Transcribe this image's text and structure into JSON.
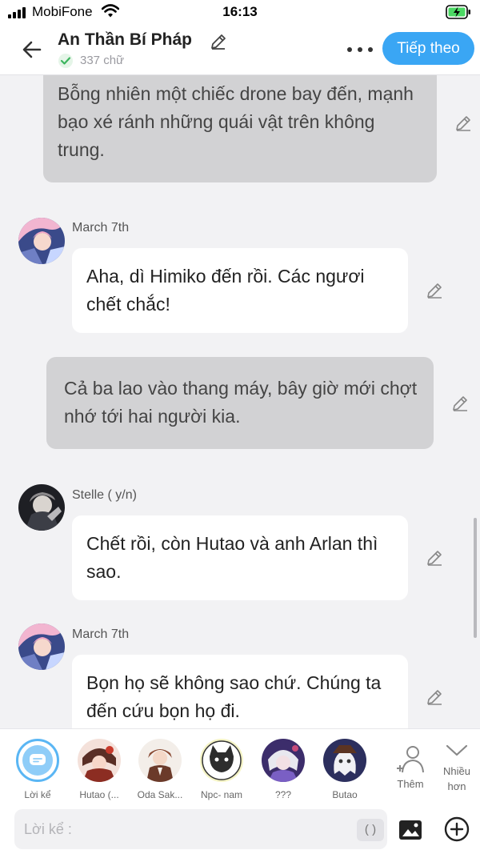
{
  "status_bar": {
    "carrier": "MobiFone",
    "time": "16:13"
  },
  "header": {
    "title": "An Thần Bí Pháp",
    "word_count": "337 chữ",
    "next_label": "Tiếp theo",
    "icons": {
      "back": "arrow-left-icon",
      "edit": "pencil-icon",
      "verified": "check-circle-icon",
      "more": "more-dots-icon"
    }
  },
  "messages": [
    {
      "type": "narration",
      "text": "Bỗng nhiên một chiếc drone bay đến, mạnh bạo xé ránh những quái vật trên không trung."
    },
    {
      "type": "speech",
      "speaker": "March 7th",
      "text": "Aha, dì Himiko đến rồi. Các ngươi chết chắc!"
    },
    {
      "type": "narration",
      "text": "Cả ba lao vào thang máy, bây giờ mới chợt nhớ tới hai người kia."
    },
    {
      "type": "speech",
      "speaker": "Stelle ( y/n)",
      "text": "Chết rồi, còn Hutao và anh Arlan thì sao."
    },
    {
      "type": "speech",
      "speaker": "March 7th",
      "text": "Bọn họ sẽ không sao chứ. Chúng ta đến cứu bọn họ đi."
    }
  ],
  "characters": [
    {
      "name": "Lời kể"
    },
    {
      "name": "Hutao (..."
    },
    {
      "name": "Oda Sak..."
    },
    {
      "name": "Npc- nam"
    },
    {
      "name": "???"
    },
    {
      "name": "Butao"
    }
  ],
  "actions": {
    "add_label": "Thêm",
    "more_label_1": "Nhiều",
    "more_label_2": "hơn"
  },
  "input": {
    "placeholder": "Lời kể :",
    "paren_label": "( )"
  },
  "colors": {
    "accent": "#3aa6f4",
    "narration_bg": "#d2d2d4",
    "speech_bg": "#ffffff",
    "chat_bg": "#f2f2f4"
  }
}
